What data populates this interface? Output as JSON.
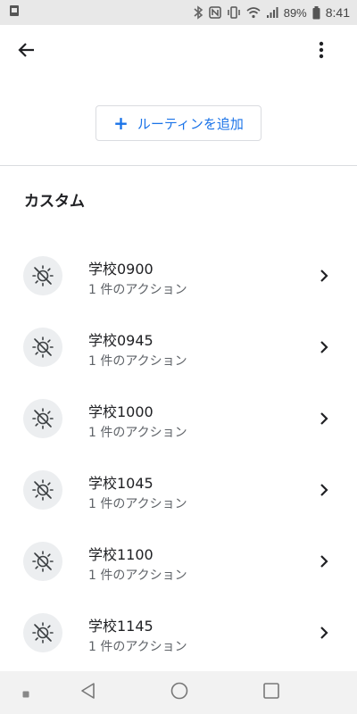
{
  "status_bar": {
    "battery": "89%",
    "time": "8:41",
    "icons": [
      "sim-icon",
      "bluetooth-icon",
      "nfc-icon",
      "vibrate-icon",
      "wifi-icon",
      "signal-icon",
      "battery-icon"
    ]
  },
  "app_bar": {
    "back_icon": "arrow-back-icon",
    "more_icon": "more-vert-icon"
  },
  "add_routine": {
    "plus": "+",
    "label": "ルーティンを追加",
    "color": "#1a73e8"
  },
  "section": {
    "title": "カスタム"
  },
  "routines": [
    {
      "name": "学校0900",
      "subtitle": "1 件のアクション",
      "icon": "routine-sun-off-icon"
    },
    {
      "name": "学校0945",
      "subtitle": "1 件のアクション",
      "icon": "routine-sun-off-icon"
    },
    {
      "name": "学校1000",
      "subtitle": "1 件のアクション",
      "icon": "routine-sun-off-icon"
    },
    {
      "name": "学校1045",
      "subtitle": "1 件のアクション",
      "icon": "routine-sun-off-icon"
    },
    {
      "name": "学校1100",
      "subtitle": "1 件のアクション",
      "icon": "routine-sun-off-icon"
    },
    {
      "name": "学校1145",
      "subtitle": "1 件のアクション",
      "icon": "routine-sun-off-icon"
    }
  ],
  "nav_bar": {
    "icons": [
      "recents-dot-icon",
      "back-triangle-icon",
      "home-circle-icon",
      "overview-square-icon"
    ]
  }
}
